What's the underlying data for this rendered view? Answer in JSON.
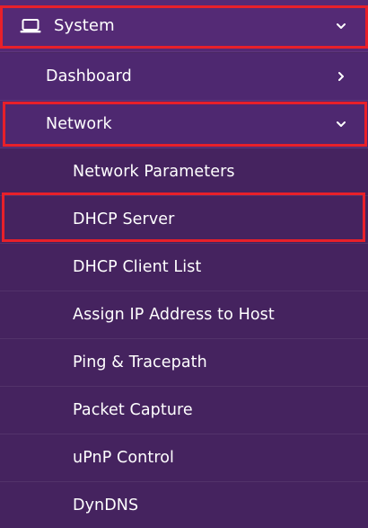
{
  "menu": {
    "system": {
      "label": "System",
      "icon": "laptop-icon",
      "state": "expanded"
    },
    "items": [
      {
        "label": "Dashboard",
        "state": "collapsed"
      },
      {
        "label": "Network",
        "state": "expanded"
      }
    ],
    "network_items": [
      {
        "label": "Network Parameters"
      },
      {
        "label": "DHCP Server"
      },
      {
        "label": "DHCP Client List"
      },
      {
        "label": "Assign IP Address to Host"
      },
      {
        "label": "Ping & Tracepath"
      },
      {
        "label": "Packet Capture"
      },
      {
        "label": "uPnP Control"
      },
      {
        "label": "DynDNS"
      }
    ]
  },
  "colors": {
    "highlight": "#e8202a",
    "text": "#ffffff",
    "background": "#4a2663"
  }
}
